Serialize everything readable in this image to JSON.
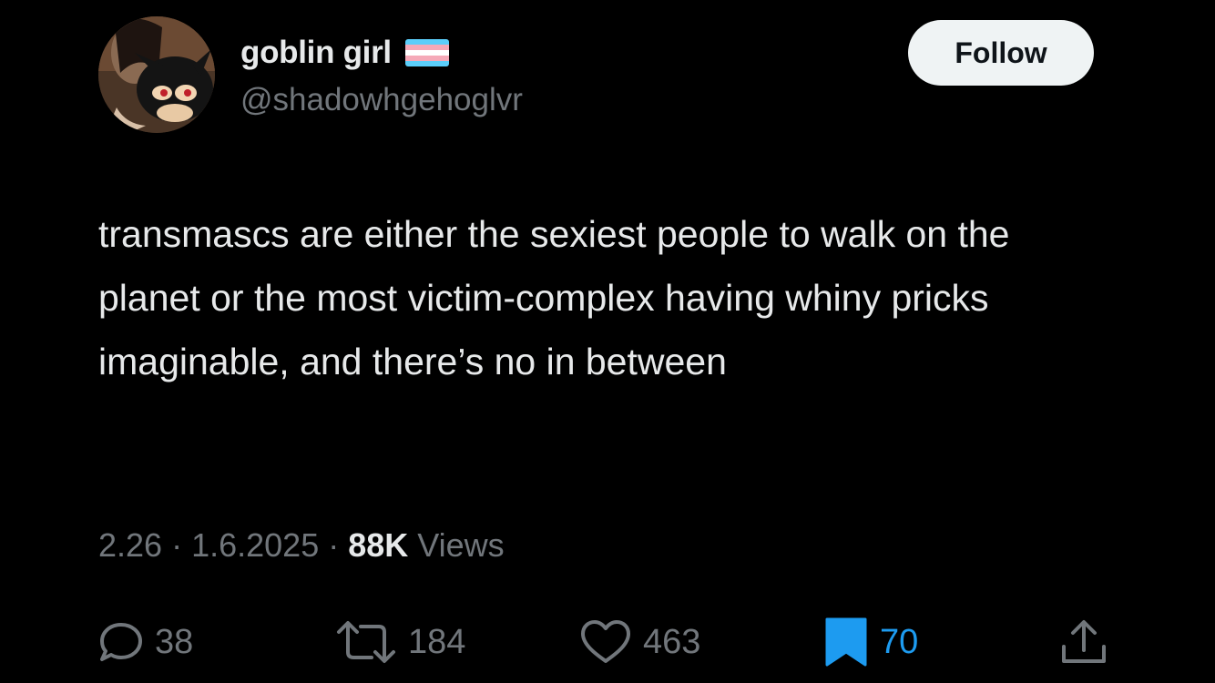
{
  "user": {
    "display_name": "goblin girl",
    "handle": "@shadowhgehoglvr",
    "flag_icon": "transgender-flag-icon",
    "flag_colors": [
      "#5bcefa",
      "#f5a9b8",
      "#ffffff",
      "#f5a9b8",
      "#5bcefa"
    ]
  },
  "follow_button": {
    "label": "Follow"
  },
  "tweet": {
    "text": "transmascs are either the sexiest people to walk on the planet or the most victim-complex having whiny pricks imaginable, and there’s no in between"
  },
  "meta": {
    "time": "2.26",
    "separator": " · ",
    "date": "1.6.2025",
    "views_count": "88K",
    "views_label": " Views"
  },
  "actions": {
    "replies": {
      "icon": "reply-icon",
      "count": "38"
    },
    "reposts": {
      "icon": "repost-icon",
      "count": "184"
    },
    "likes": {
      "icon": "heart-icon",
      "count": "463"
    },
    "bookmarks": {
      "icon": "bookmark-icon",
      "count": "70",
      "active": true
    },
    "share": {
      "icon": "share-icon"
    }
  },
  "colors": {
    "background": "#000000",
    "text_primary": "#e7e9ea",
    "text_secondary": "#71767b",
    "accent": "#1d9bf0",
    "follow_bg": "#eff3f4"
  }
}
